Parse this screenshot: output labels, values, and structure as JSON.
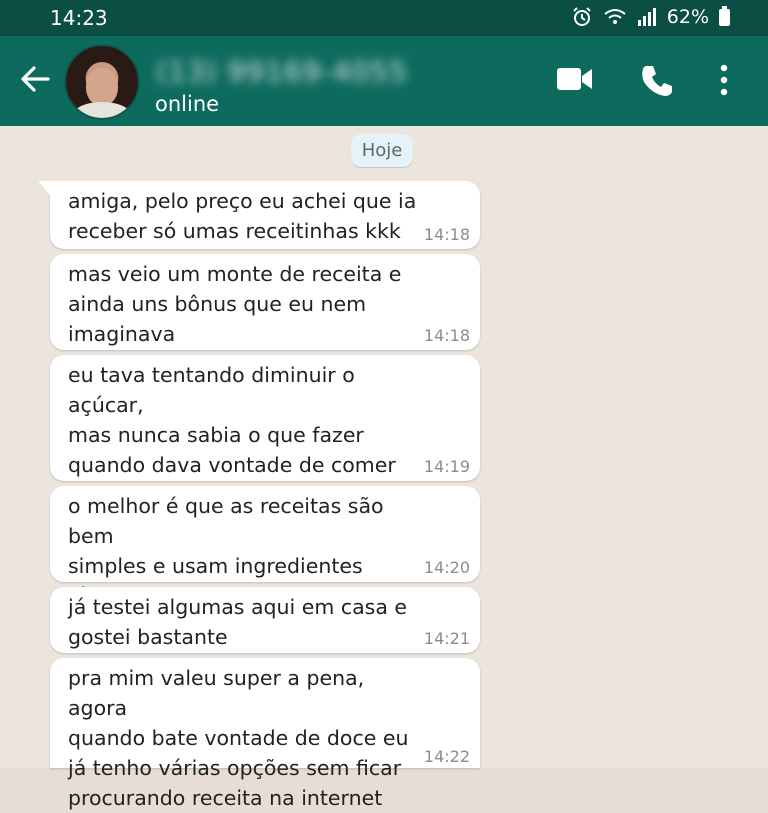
{
  "status_bar": {
    "time": "14:23",
    "battery": "62%",
    "icons": [
      "alarm-icon",
      "wifi-icon",
      "signal-icon",
      "battery-icon"
    ]
  },
  "header": {
    "contact_name": "(13) 99169-4055",
    "contact_status": "online",
    "icons": [
      "back-arrow-icon",
      "avatar",
      "video-call-icon",
      "voice-call-icon",
      "menu-dots-icon"
    ]
  },
  "chat": {
    "date_chip": "Hoje",
    "messages": [
      {
        "text": "amiga, pelo preço eu achei que ia\nreceber só umas receitinhas kkk",
        "time": "14:18"
      },
      {
        "text": "mas veio um monte de receita e\nainda uns bônus que eu nem\nimaginava",
        "time": "14:18"
      },
      {
        "text": "eu tava tentando diminuir o açúcar,\nmas nunca sabia o que fazer\nquando dava vontade de comer\num doce",
        "time": "14:19"
      },
      {
        "text": "o melhor é que as receitas são bem\nsimples e usam ingredientes fáceis\nde encontrar",
        "time": "14:20"
      },
      {
        "text": "já testei algumas aqui em casa e\ngostei bastante",
        "time": "14:21"
      },
      {
        "text": "pra mim valeu super a pena, agora\nquando bate vontade de doce eu\njá tenho várias opções sem ficar\nprocurando receita na internet",
        "time": "14:22"
      }
    ]
  },
  "colors": {
    "header": "#0d6b5e",
    "status_bar": "#0b4e44",
    "chat_background": "#ece5dd",
    "bubble": "#ffffff"
  }
}
